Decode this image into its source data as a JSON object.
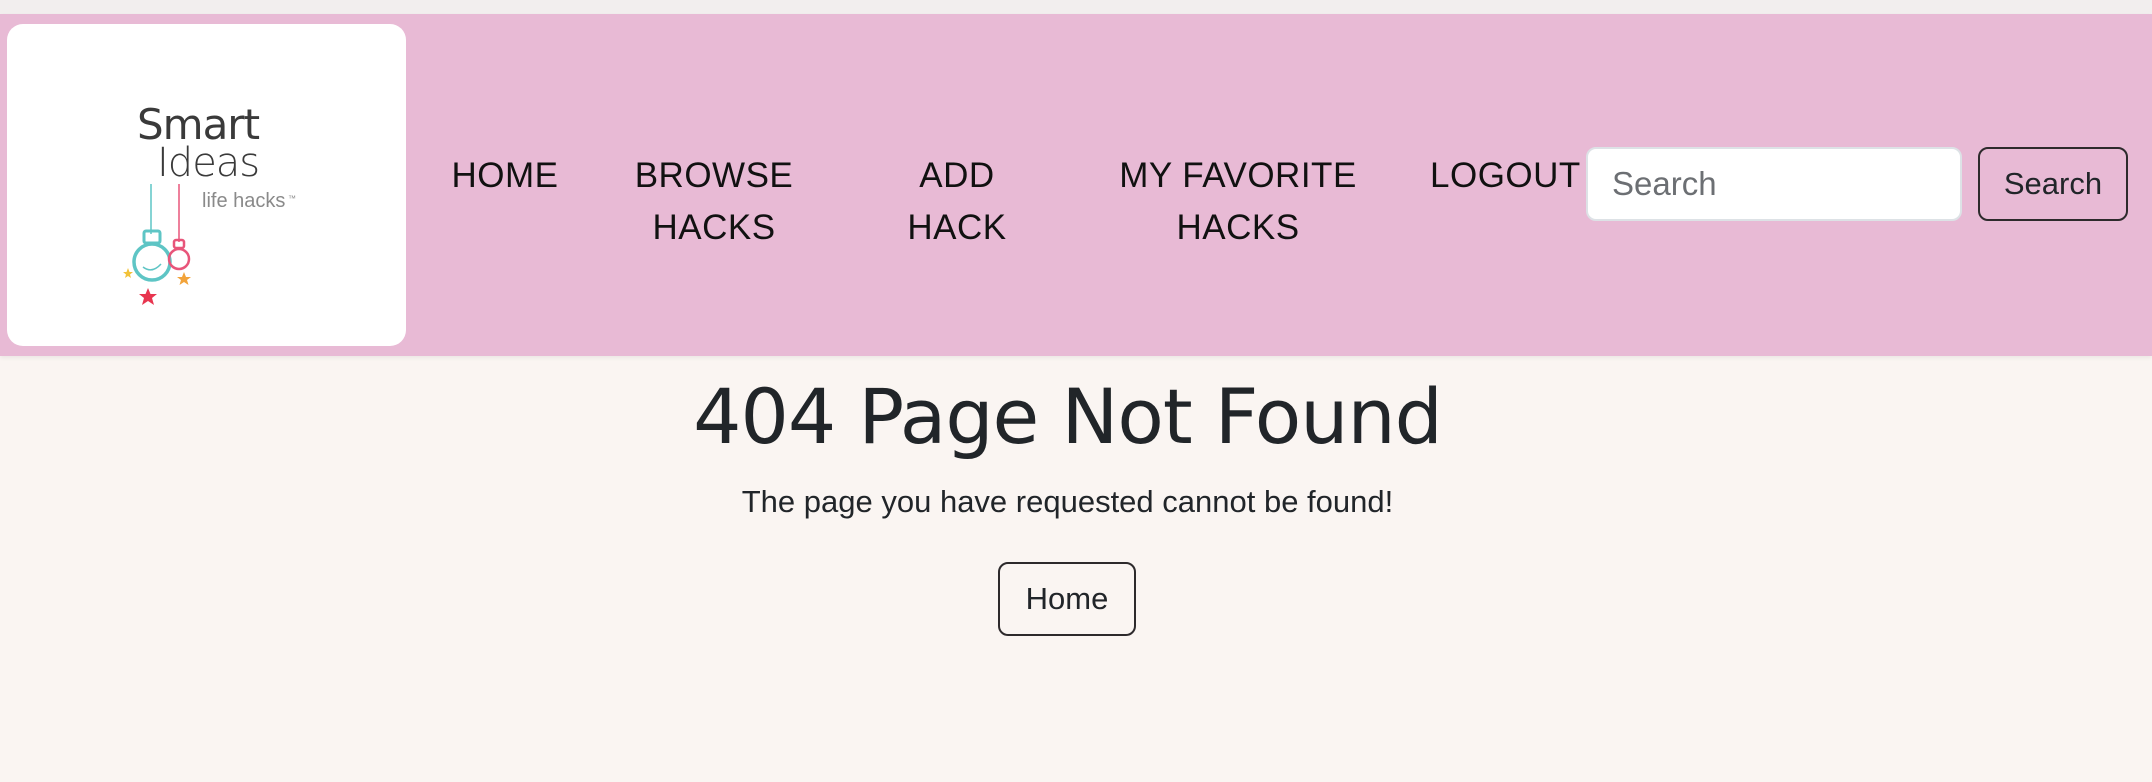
{
  "logo": {
    "line1": "Smart",
    "line2": "Ideas",
    "line3": "life hacks",
    "trademark": "™"
  },
  "nav": {
    "items": [
      {
        "label": "HOME"
      },
      {
        "label": "BROWSE HACKS"
      },
      {
        "label": "ADD HACK"
      },
      {
        "label": "MY FAVORITE HACKS"
      },
      {
        "label": "LOGOUT"
      }
    ]
  },
  "search": {
    "placeholder": "Search",
    "value": "",
    "button_label": "Search"
  },
  "main": {
    "title": "404 Page Not Found",
    "message": "The page you have requested cannot be found!",
    "home_button_label": "Home"
  },
  "colors": {
    "navbar_bg": "#e8bad5",
    "page_bg": "#faf5f2",
    "text": "#212529",
    "bulb_teal": "#5ec5c5",
    "bulb_pink": "#e8557a",
    "star_orange": "#f2a33a",
    "star_red": "#e8354f"
  }
}
